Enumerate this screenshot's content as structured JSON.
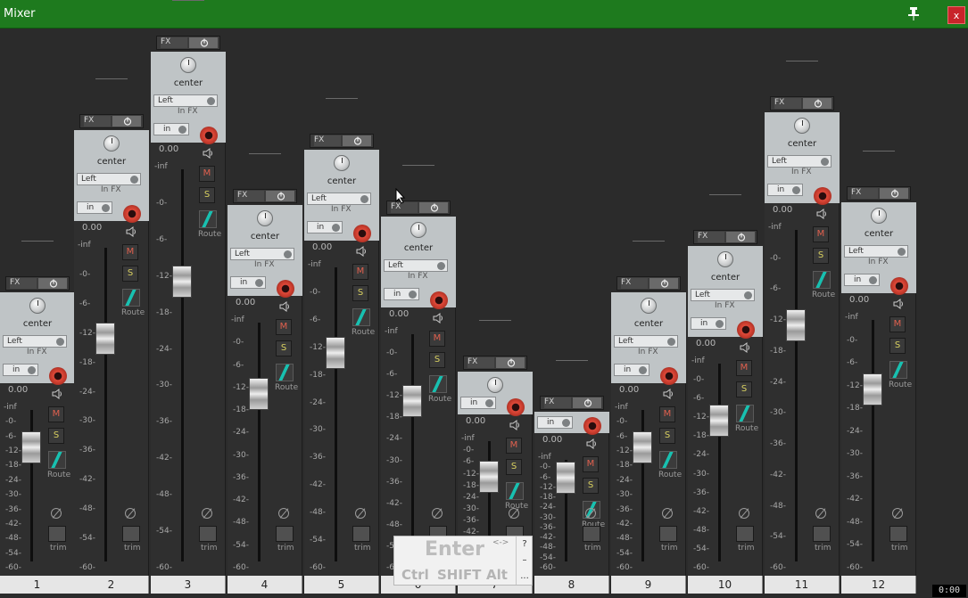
{
  "window": {
    "title": "Mixer",
    "close_label": "x"
  },
  "common": {
    "fx_label": "FX",
    "pan_label": "center",
    "io_label": "Left",
    "infx_label": "In FX",
    "in_label": "in",
    "mute_label": "M",
    "solo_label": "S",
    "route_label": "Route",
    "trim_label": "trim",
    "volume": "0.00"
  },
  "scale_labels": [
    "-inf",
    "-0-",
    "-6-",
    "-12-",
    "-18-",
    "-24-",
    "-30-",
    "-36-",
    "-42-",
    "-48-",
    "-54-",
    "-60-"
  ],
  "tracks": [
    {
      "number": "1"
    },
    {
      "number": "2"
    },
    {
      "number": "3"
    },
    {
      "number": "4"
    },
    {
      "number": "5"
    },
    {
      "number": "6"
    },
    {
      "number": "7"
    },
    {
      "number": "8"
    },
    {
      "number": "9"
    },
    {
      "number": "10"
    },
    {
      "number": "11"
    },
    {
      "number": "12"
    }
  ],
  "onscreen_keyboard": {
    "enter": "Enter",
    "arrows": "<->",
    "ctrl": "Ctrl",
    "shift": "SHIFT",
    "alt": "Alt",
    "side": [
      "?",
      "–",
      "..."
    ]
  },
  "time_display": "0:00",
  "colors": {
    "titlebar": "#1e7a1e",
    "close": "#c8242a",
    "arm": "#c43a2c",
    "route": "#18c0b0"
  }
}
